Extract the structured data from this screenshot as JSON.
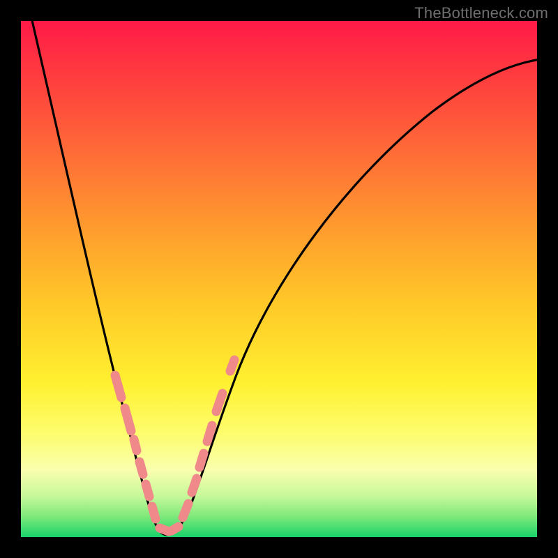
{
  "watermark": "TheBottleneck.com",
  "colors": {
    "gradient_top": "#ff1a48",
    "gradient_mid": "#fff030",
    "gradient_bottom": "#18d36a",
    "curve": "#000000",
    "beads": "#f08a8a",
    "frame": "#000000",
    "watermark_text": "#6f6f6f"
  },
  "chart_data": {
    "type": "line",
    "title": "",
    "xlabel": "",
    "ylabel": "",
    "xlim": [
      0,
      100
    ],
    "ylim": [
      0,
      100
    ],
    "note": "No axis ticks or data labels are visible; x/y values are estimated from pixel positions on a 0–100 scale. Curve shows a deep V with minimum near x≈27, y≈0; a green band at the bottom indicates low bottleneck, red at top indicates high.",
    "series": [
      {
        "name": "bottleneck-curve",
        "x": [
          2,
          7,
          12,
          17,
          22,
          25,
          27,
          29,
          33,
          40,
          50,
          60,
          72,
          85,
          100
        ],
        "y": [
          100,
          78,
          58,
          40,
          20,
          8,
          0,
          6,
          18,
          38,
          58,
          72,
          83,
          90,
          93
        ]
      }
    ],
    "highlighted_range_x": [
      18,
      41
    ],
    "background_gradient": {
      "orientation": "vertical",
      "stops": [
        {
          "pos": 0.0,
          "color": "#ff1a48"
        },
        {
          "pos": 0.4,
          "color": "#ff9b2e"
        },
        {
          "pos": 0.7,
          "color": "#fff030"
        },
        {
          "pos": 0.9,
          "color": "#c7f89a"
        },
        {
          "pos": 1.0,
          "color": "#18d36a"
        }
      ]
    }
  }
}
